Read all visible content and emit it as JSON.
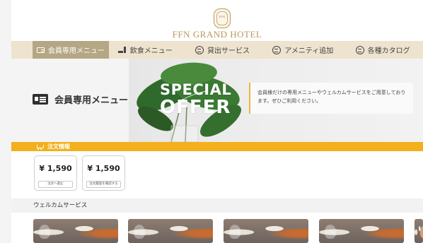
{
  "header": {
    "logo_text": "FFN",
    "brand_name": "FFN GRAND HOTEL"
  },
  "nav": {
    "items": [
      {
        "label": "会員専用メニュー",
        "icon": "member-card-icon",
        "active": true
      },
      {
        "label": "飲食メニュー",
        "icon": "dining-icon",
        "active": false
      },
      {
        "label": "貸出サービス",
        "icon": "rental-icon",
        "active": false
      },
      {
        "label": "アメニティ追加",
        "icon": "amenity-icon",
        "active": false
      },
      {
        "label": "各種カタログ",
        "icon": "catalog-icon",
        "active": false
      }
    ]
  },
  "hero": {
    "title": "会員専用メニュー",
    "offer_line1": "SPECIAL",
    "offer_line2": "OFFER",
    "message": "会員様だけの専用メニューやウェルカムサービスをご用意しております。ぜひご利用ください。"
  },
  "order": {
    "section_label": "注文情報",
    "cards": [
      {
        "price": "¥ 1,590",
        "button": "注文へ進む"
      },
      {
        "price": "¥ 1,590",
        "button": "注文履歴を確認する"
      }
    ]
  },
  "welcome": {
    "section_label": "ウェルカムサービス"
  },
  "colors": {
    "accent_gold": "#b89a5a",
    "nav_bg": "#ede3ce",
    "nav_active": "#b5a684",
    "order_bar": "#f3b01c"
  }
}
